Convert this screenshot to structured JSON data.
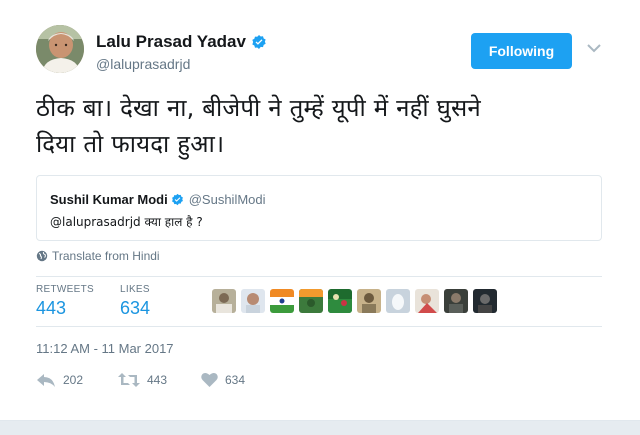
{
  "author": {
    "name": "Lalu Prasad Yadav",
    "handle": "@laluprasadrjd",
    "verified": true
  },
  "follow_button": {
    "label": "Following",
    "color": "#1da1f2"
  },
  "tweet": {
    "text_line1": "ठीक बा। देखा ना, बीजेपी ने तुम्हें यूपी में नहीं घुसने",
    "text_line2": "दिया तो फायदा हुआ।"
  },
  "quoted_tweet": {
    "name": "Sushil Kumar Modi",
    "handle": "@SushilModi",
    "verified": true,
    "text": "@laluprasadrjd क्या हाल है ?"
  },
  "translate": {
    "icon": "globe-icon",
    "label": "Translate from Hindi"
  },
  "stats": {
    "retweets_label": "RETWEETS",
    "retweets_value": "443",
    "likes_label": "LIKES",
    "likes_value": "634",
    "liker_avatar_count": 10
  },
  "timestamp": "11:12 AM - 11 Mar 2017",
  "actions": {
    "reply": {
      "icon": "reply-icon",
      "count": "202"
    },
    "retweet": {
      "icon": "retweet-icon",
      "count": "443"
    },
    "like": {
      "icon": "heart-icon",
      "count": "634"
    }
  },
  "colors": {
    "accent": "#1da1f2",
    "stat_value": "#1b95e0",
    "secondary_text": "#657786",
    "border": "#e1e8ed"
  }
}
